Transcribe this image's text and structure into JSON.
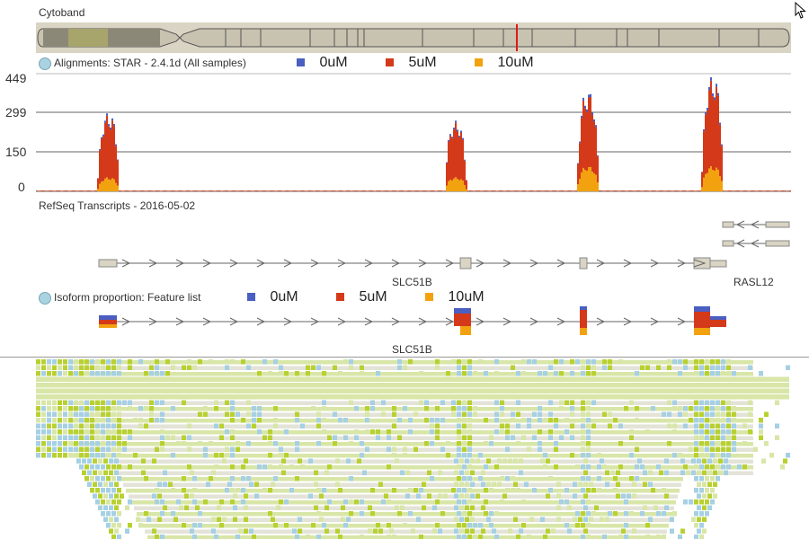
{
  "cytoband": {
    "title": "Cytoband"
  },
  "alignments": {
    "title": "Alignments: STAR - 2.4.1d (All samples)",
    "legend": [
      {
        "label": "0uM",
        "color": "#4a5fc1"
      },
      {
        "label": "5uM",
        "color": "#d43a1a"
      },
      {
        "label": "10uM",
        "color": "#f2a20e"
      }
    ]
  },
  "chart_data": {
    "type": "area",
    "yticks": [
      "449",
      "299",
      "150",
      "0"
    ],
    "ylim": [
      0,
      449
    ],
    "series": [
      {
        "name": "0uM",
        "color": "#4a5fc1"
      },
      {
        "name": "5uM",
        "color": "#d43a1a"
      },
      {
        "name": "10uM",
        "color": "#f2a20e"
      }
    ],
    "peaks": [
      {
        "center": 0.095,
        "total": 300,
        "pct10": 0.18
      },
      {
        "center": 0.555,
        "total": 270,
        "pct10": 0.2
      },
      {
        "center": 0.73,
        "total": 385,
        "pct10": 0.25
      },
      {
        "center": 0.895,
        "total": 440,
        "pct10": 0.22
      }
    ]
  },
  "refseq": {
    "title": "RefSeq Transcripts - 2016-05-02",
    "gene1": "SLC51B",
    "gene2": "RASL12"
  },
  "isoform": {
    "title": "Isoform proportion: Feature list",
    "legend": [
      {
        "label": "0uM",
        "color": "#4a5fc1"
      },
      {
        "label": "5uM",
        "color": "#d43a1a"
      },
      {
        "label": "10uM",
        "color": "#f2a20e"
      }
    ],
    "gene": "SLC51B"
  },
  "colors": {
    "reads_light": "#d8e6a8",
    "reads_dark": "#b8d130",
    "reads_gray": "#e3e3d8",
    "reads_blue": "#a6d0e4"
  }
}
